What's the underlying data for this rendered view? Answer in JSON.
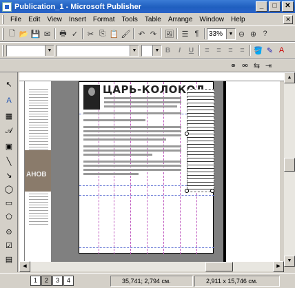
{
  "window": {
    "title": "Publication_1 - Microsoft Publisher",
    "minimize": "_",
    "maximize": "□",
    "close": "✕"
  },
  "menu": {
    "items": [
      "File",
      "Edit",
      "View",
      "Insert",
      "Format",
      "Tools",
      "Table",
      "Arrange",
      "Window",
      "Help"
    ],
    "doc_close": "✕"
  },
  "toolbar": {
    "zoom_value": "33%",
    "zoom_out": "⊖",
    "zoom_in": "⊕",
    "bold": "B",
    "italic": "I",
    "underline": "U"
  },
  "document": {
    "heading": "ЦАРЬ-КОЛОКОЛ",
    "left_page_photo_text": "АНОВ"
  },
  "status": {
    "pages": [
      "1",
      "2",
      "3",
      "4"
    ],
    "active_page": "2",
    "position": "35,741; 2,794 см.",
    "size": "2,911 x 15,746 см."
  },
  "colors": {
    "titlebar": "#1f5fbf",
    "guide_column": "#c05bc0",
    "guide_row": "#6a7bd6"
  }
}
